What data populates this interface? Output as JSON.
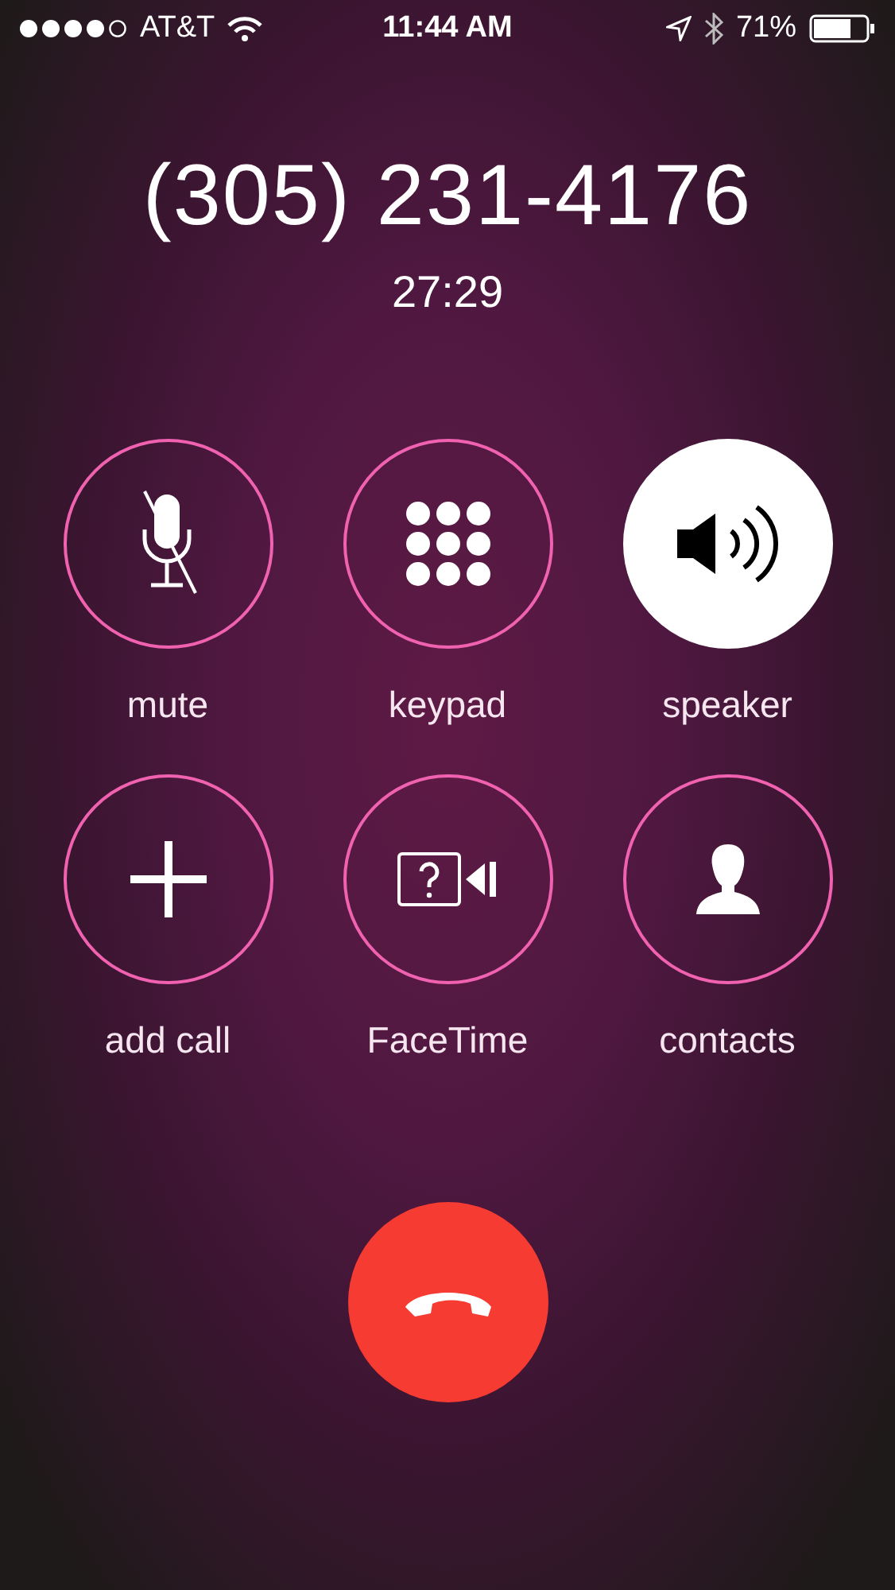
{
  "status_bar": {
    "carrier": "AT&T",
    "time": "11:44 AM",
    "battery": "71%"
  },
  "call": {
    "number": "(305) 231-4176",
    "duration": "27:29"
  },
  "buttons": [
    {
      "kind": "mute",
      "label": "mute",
      "on": false
    },
    {
      "kind": "keypad",
      "label": "keypad",
      "on": false
    },
    {
      "kind": "speaker",
      "label": "speaker",
      "on": true
    },
    {
      "kind": "add",
      "label": "add call",
      "on": false
    },
    {
      "kind": "facetime",
      "label": "FaceTime",
      "on": false
    },
    {
      "kind": "contacts",
      "label": "contacts",
      "on": false
    }
  ]
}
